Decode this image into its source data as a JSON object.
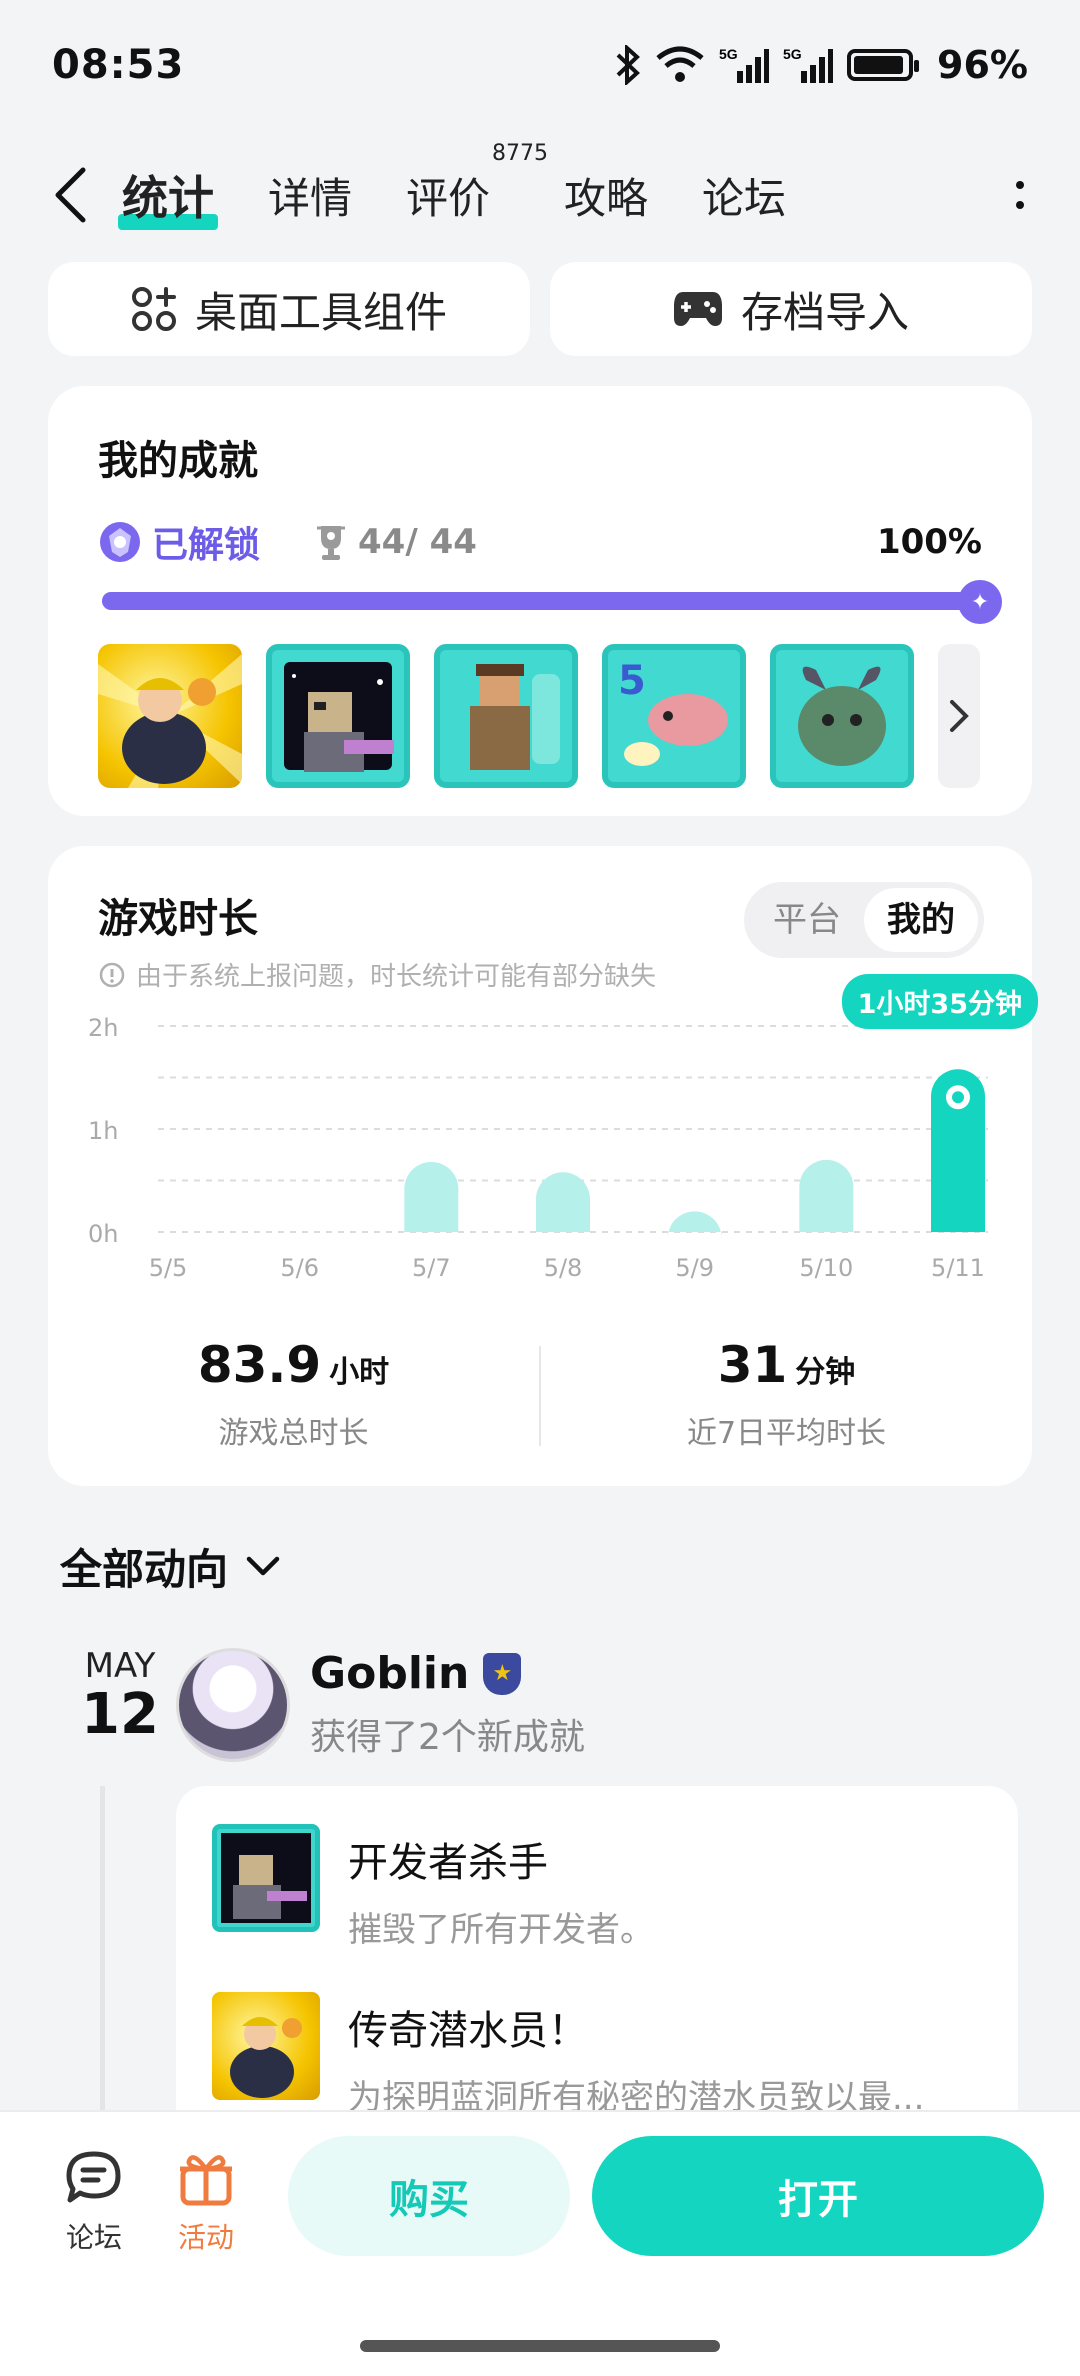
{
  "status_bar": {
    "time": "08:53",
    "battery": "96%",
    "signal_labels": [
      "5G",
      "5G"
    ]
  },
  "nav": {
    "tabs": [
      {
        "label": "统计",
        "active": true
      },
      {
        "label": "详情"
      },
      {
        "label": "评价",
        "badge": "8775"
      },
      {
        "label": "攻略"
      },
      {
        "label": "论坛"
      }
    ]
  },
  "tools": {
    "widget": "桌面工具组件",
    "import": "存档导入"
  },
  "achievements": {
    "title": "我的成就",
    "unlocked_label": "已解锁",
    "count": "44/ 44",
    "percent": "100%",
    "progress": 1.0
  },
  "playtime": {
    "title": "游戏时长",
    "segments": [
      "平台",
      "我的"
    ],
    "notice": "由于系统上报问题，时长统计可能有部分缺失",
    "total_value": "83.9",
    "total_unit": "小时",
    "total_label": "游戏总时长",
    "avg_value": "31",
    "avg_unit": "分钟",
    "avg_label": "近7日平均时长"
  },
  "chart_data": {
    "type": "bar",
    "categories": [
      "5/5",
      "5/6",
      "5/7",
      "5/8",
      "5/9",
      "5/10",
      "5/11"
    ],
    "values": [
      0,
      0,
      0.68,
      0.58,
      0.2,
      0.7,
      1.58
    ],
    "unit": "h",
    "ylim": [
      0,
      2
    ],
    "y_ticks": [
      "0h",
      "1h",
      "2h"
    ],
    "highlight_index": 6,
    "highlight_label": "1小时35分钟",
    "colors": {
      "bar": "#b5f0ea",
      "highlight": "#14d6c0"
    }
  },
  "feed": {
    "header": "全部动向",
    "date_month": "MAY",
    "date_day": "12",
    "user": "Goblin",
    "summary": "获得了2个新成就",
    "items": [
      {
        "title": "开发者杀手",
        "desc": "摧毁了所有开发者。"
      },
      {
        "title": "传奇潜水员！",
        "desc": "为探明蓝洞所有秘密的潜水员致以最..."
      }
    ]
  },
  "bottom": {
    "forum": "论坛",
    "activity": "活动",
    "buy": "购买",
    "open": "打开"
  },
  "colors": {
    "accent": "#14d6c0",
    "purple": "#7b68ee",
    "orange": "#f07b3f"
  }
}
